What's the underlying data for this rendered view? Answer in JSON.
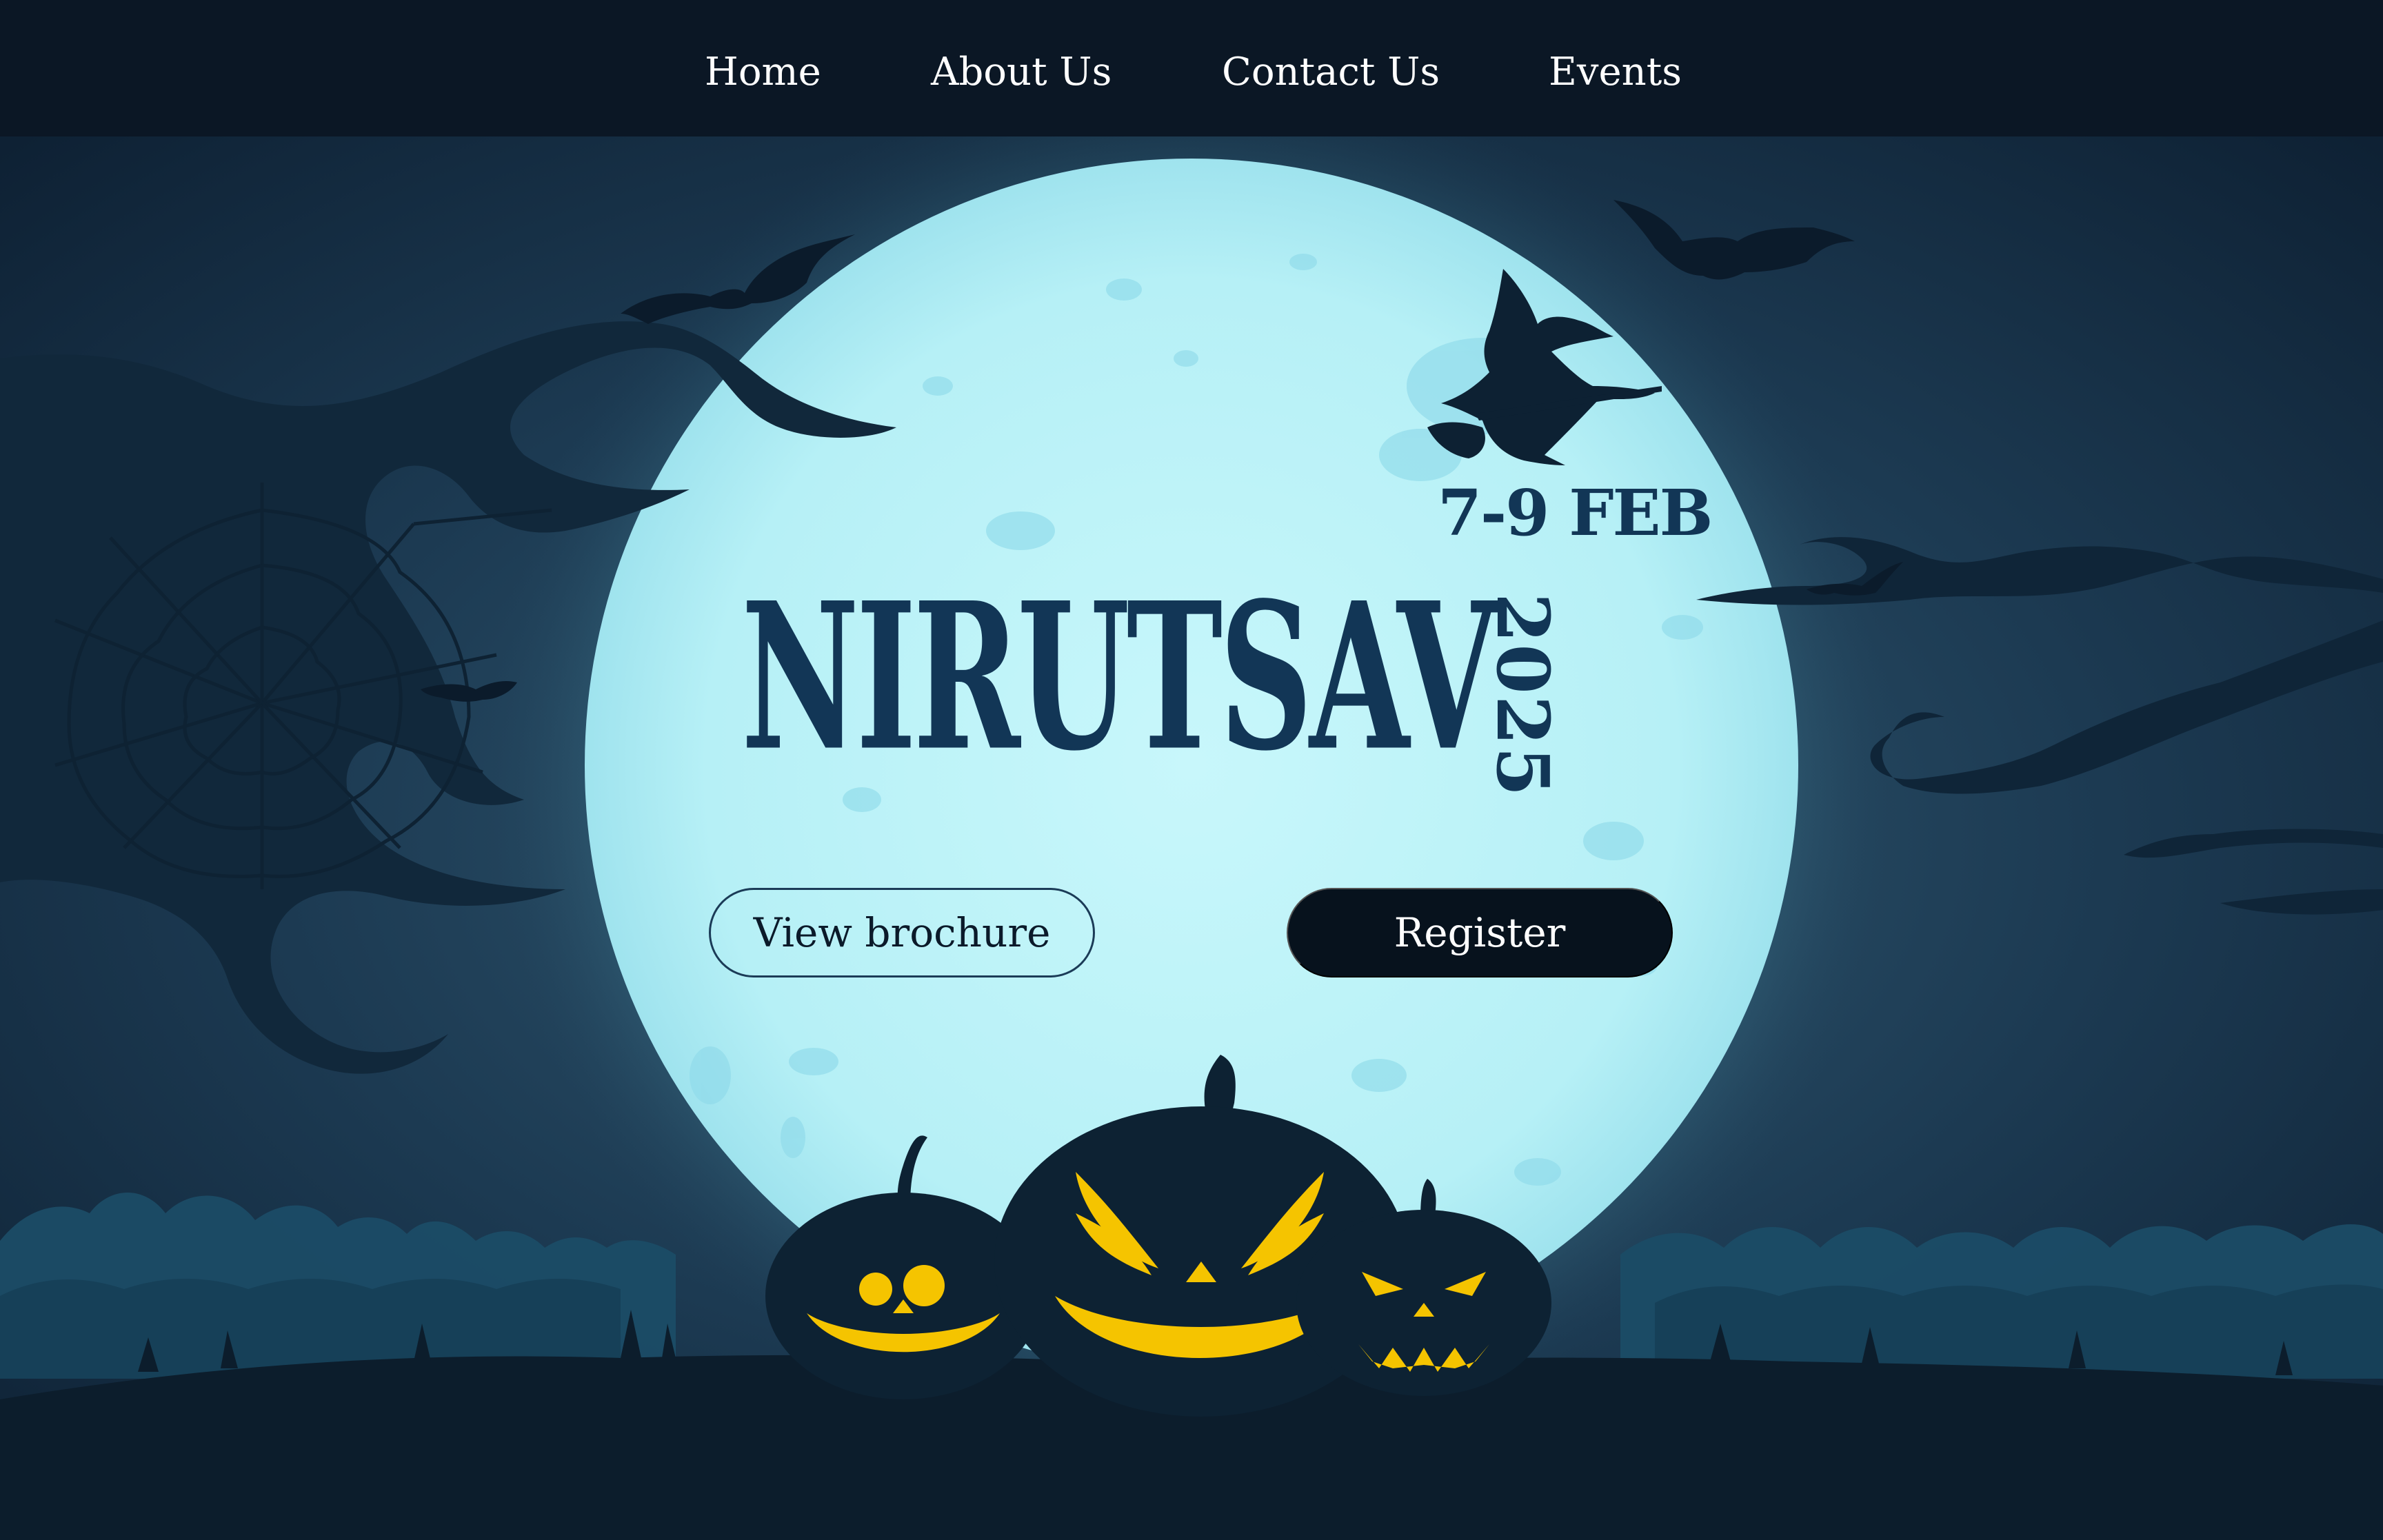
{
  "nav": {
    "items": [
      {
        "label": "Home"
      },
      {
        "label": "About Us"
      },
      {
        "label": "Contact Us"
      },
      {
        "label": "Events"
      }
    ]
  },
  "hero": {
    "date": "7-9 FEB",
    "title": "NIRUTSAV",
    "year": "2025",
    "brochure_label": "View brochure",
    "register_label": "Register"
  },
  "colors": {
    "nav_bg": "#0b1725",
    "moon": "#b9f1f7",
    "ink": "#123656",
    "pumpkin": "#0d2233",
    "pumpkin_face": "#f5c400",
    "button_dark": "#07121d"
  },
  "decor": {
    "icons": [
      "bat-icon",
      "witch-icon",
      "spider-web-icon",
      "pumpkin-icon",
      "tree-branch-icon",
      "moon-icon"
    ]
  }
}
